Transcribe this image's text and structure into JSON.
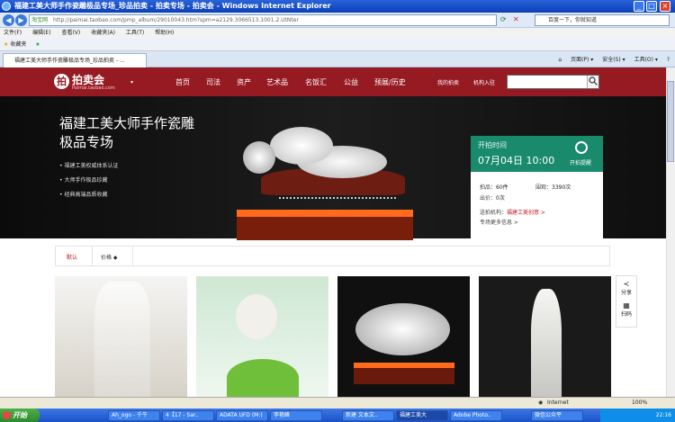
{
  "window": {
    "title": "福建工美大师手作瓷雕极品专场_珍品拍卖 - 拍卖专场 - 拍卖会 - Windows Internet Explorer"
  },
  "address": {
    "tag": "淘宝网",
    "url": "http://paimai.taobao.com/pmp_album/29010043.htm?spm=a2129.3066513.1001.2.UtNter",
    "search_placeholder": "百度一下，你就知道"
  },
  "menu": [
    "文件(F)",
    "编辑(E)",
    "查看(V)",
    "收藏夹(A)",
    "工具(T)",
    "帮助(H)"
  ],
  "favorites": {
    "label": "收藏夹"
  },
  "tab": {
    "title": "福建工美大师手作瓷雕极品专场_珍品拍卖 - ...",
    "tools": [
      "页面(P) ▾",
      "安全(S) ▾",
      "工具(O) ▾"
    ]
  },
  "site": {
    "logo": "拍卖会",
    "logo_sub": "Paimai.taobao.com",
    "nav": [
      "首页",
      "司法",
      "资产",
      "艺术品",
      "名饭汇",
      "公益",
      "预展/历史"
    ],
    "nav_right": [
      "我的拍卖",
      "机构入驻"
    ]
  },
  "banner": {
    "title_line1": "福建工美大师手作瓷雕",
    "title_line2": "极品专场",
    "bullets": [
      "福建工美权威体系认证",
      "大师手作极品珍藏",
      "经典高端品质收藏"
    ]
  },
  "auction": {
    "start_label": "开拍时间",
    "start_time": "07月04日 10:00",
    "remind": "开拍提醒",
    "lots_label": "拍品：",
    "lots_value": "60件",
    "views_label": "围观：",
    "views_value": "3390次",
    "bids_label": "出价：",
    "bids_value": "0次",
    "seller_label": "送拍机构：",
    "seller_value": "福建工美创意 >",
    "more": "专场更多信息 >"
  },
  "filters": {
    "default": "默认",
    "price": "价格 ◆"
  },
  "side": {
    "share": "分享",
    "scan": "扫码"
  },
  "status": {
    "zone": "Internet",
    "zoom": "100%"
  },
  "taskbar": {
    "start": "开始",
    "tasks": [
      "Ah_ogo - 千牛",
      "4【17 - Sar..",
      "ADATA UFD (M:)",
      "李艳峰",
      "新建 文本文..",
      "福建工美大",
      "Adobe Photo..",
      "微信公众平"
    ],
    "time": "22:16"
  }
}
